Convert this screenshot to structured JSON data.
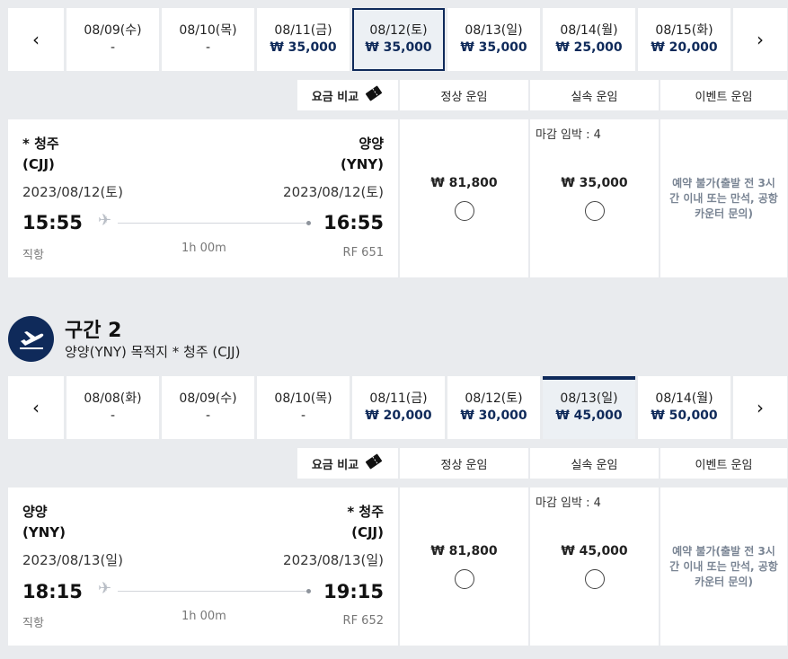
{
  "segment1": {
    "dates": [
      {
        "date": "08/09(수)",
        "price": "-"
      },
      {
        "date": "08/10(목)",
        "price": "-"
      },
      {
        "date": "08/11(금)",
        "price": "₩ 35,000"
      },
      {
        "date": "08/12(토)",
        "price": "₩ 35,000"
      },
      {
        "date": "08/13(일)",
        "price": "₩ 35,000"
      },
      {
        "date": "08/14(월)",
        "price": "₩ 25,000"
      },
      {
        "date": "08/15(화)",
        "price": "₩ 20,000"
      }
    ],
    "fare_header": {
      "compare": "요금 비교",
      "normal": "정상 운임",
      "discount": "실속 운임",
      "event": "이벤트 운임"
    },
    "flight": {
      "origin_city": "* 청주",
      "origin_code": "(CJJ)",
      "origin_date": "2023/08/12(토)",
      "depart_time": "15:55",
      "dest_city": "양양",
      "dest_code": "(YNY)",
      "dest_date": "2023/08/12(토)",
      "arrive_time": "16:55",
      "type": "직항",
      "duration": "1h 00m",
      "flight_no": "RF 651",
      "normal_price": "₩ 81,800",
      "discount_deadline": "마감 임박 : 4",
      "discount_price": "₩ 35,000",
      "event_text": "예약 불가(출발 전 3시간 이내 또는 만석, 공항 카운터 문의)"
    }
  },
  "segment2": {
    "title": "구간 2",
    "route": "양양(YNY) 목적지 * 청주 (CJJ)",
    "dates": [
      {
        "date": "08/08(화)",
        "price": "-"
      },
      {
        "date": "08/09(수)",
        "price": "-"
      },
      {
        "date": "08/10(목)",
        "price": "-"
      },
      {
        "date": "08/11(금)",
        "price": "₩ 20,000"
      },
      {
        "date": "08/12(토)",
        "price": "₩ 30,000"
      },
      {
        "date": "08/13(일)",
        "price": "₩ 45,000"
      },
      {
        "date": "08/14(월)",
        "price": "₩ 50,000"
      }
    ],
    "fare_header": {
      "compare": "요금 비교",
      "normal": "정상 운임",
      "discount": "실속 운임",
      "event": "이벤트 운임"
    },
    "flight": {
      "origin_city": "양양",
      "origin_code": "(YNY)",
      "origin_date": "2023/08/13(일)",
      "depart_time": "18:15",
      "dest_city": "* 청주",
      "dest_code": "(CJJ)",
      "dest_date": "2023/08/13(일)",
      "arrive_time": "19:15",
      "type": "직항",
      "duration": "1h 00m",
      "flight_no": "RF 652",
      "normal_price": "₩ 81,800",
      "discount_deadline": "마감 임박 : 4",
      "discount_price": "₩ 45,000",
      "event_text": "예약 불가(출발 전 3시간 이내 또는 만석, 공항 카운터 문의)"
    }
  },
  "icons": {
    "prev": "chevron-left-icon",
    "next": "chevron-right-icon",
    "compare": "ticket-icon",
    "plane": "airplane-icon",
    "departure": "takeoff-icon"
  }
}
